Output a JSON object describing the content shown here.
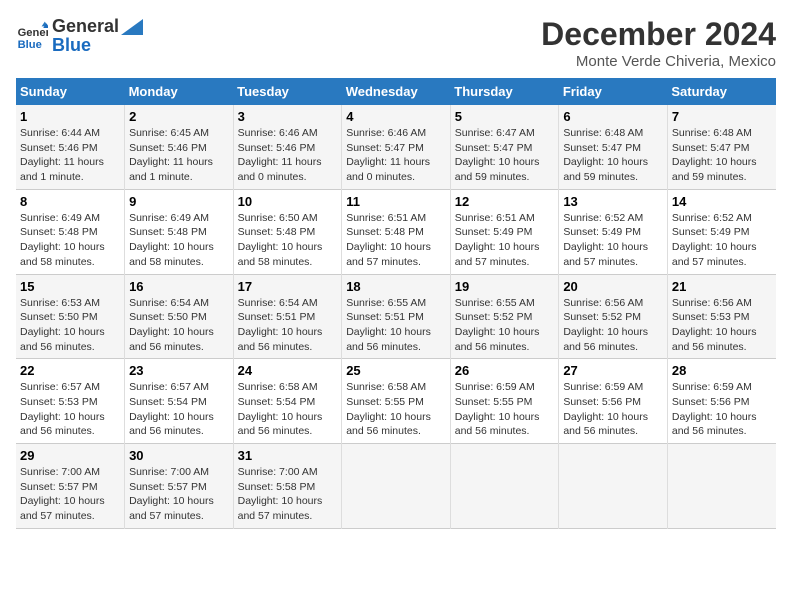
{
  "logo": {
    "line1": "General",
    "line2": "Blue"
  },
  "title": "December 2024",
  "subtitle": "Monte Verde Chiveria, Mexico",
  "days_of_week": [
    "Sunday",
    "Monday",
    "Tuesday",
    "Wednesday",
    "Thursday",
    "Friday",
    "Saturday"
  ],
  "weeks": [
    [
      {
        "day": "1",
        "detail": "Sunrise: 6:44 AM\nSunset: 5:46 PM\nDaylight: 11 hours\nand 1 minute."
      },
      {
        "day": "2",
        "detail": "Sunrise: 6:45 AM\nSunset: 5:46 PM\nDaylight: 11 hours\nand 1 minute."
      },
      {
        "day": "3",
        "detail": "Sunrise: 6:46 AM\nSunset: 5:46 PM\nDaylight: 11 hours\nand 0 minutes."
      },
      {
        "day": "4",
        "detail": "Sunrise: 6:46 AM\nSunset: 5:47 PM\nDaylight: 11 hours\nand 0 minutes."
      },
      {
        "day": "5",
        "detail": "Sunrise: 6:47 AM\nSunset: 5:47 PM\nDaylight: 10 hours\nand 59 minutes."
      },
      {
        "day": "6",
        "detail": "Sunrise: 6:48 AM\nSunset: 5:47 PM\nDaylight: 10 hours\nand 59 minutes."
      },
      {
        "day": "7",
        "detail": "Sunrise: 6:48 AM\nSunset: 5:47 PM\nDaylight: 10 hours\nand 59 minutes."
      }
    ],
    [
      {
        "day": "8",
        "detail": "Sunrise: 6:49 AM\nSunset: 5:48 PM\nDaylight: 10 hours\nand 58 minutes."
      },
      {
        "day": "9",
        "detail": "Sunrise: 6:49 AM\nSunset: 5:48 PM\nDaylight: 10 hours\nand 58 minutes."
      },
      {
        "day": "10",
        "detail": "Sunrise: 6:50 AM\nSunset: 5:48 PM\nDaylight: 10 hours\nand 58 minutes."
      },
      {
        "day": "11",
        "detail": "Sunrise: 6:51 AM\nSunset: 5:48 PM\nDaylight: 10 hours\nand 57 minutes."
      },
      {
        "day": "12",
        "detail": "Sunrise: 6:51 AM\nSunset: 5:49 PM\nDaylight: 10 hours\nand 57 minutes."
      },
      {
        "day": "13",
        "detail": "Sunrise: 6:52 AM\nSunset: 5:49 PM\nDaylight: 10 hours\nand 57 minutes."
      },
      {
        "day": "14",
        "detail": "Sunrise: 6:52 AM\nSunset: 5:49 PM\nDaylight: 10 hours\nand 57 minutes."
      }
    ],
    [
      {
        "day": "15",
        "detail": "Sunrise: 6:53 AM\nSunset: 5:50 PM\nDaylight: 10 hours\nand 56 minutes."
      },
      {
        "day": "16",
        "detail": "Sunrise: 6:54 AM\nSunset: 5:50 PM\nDaylight: 10 hours\nand 56 minutes."
      },
      {
        "day": "17",
        "detail": "Sunrise: 6:54 AM\nSunset: 5:51 PM\nDaylight: 10 hours\nand 56 minutes."
      },
      {
        "day": "18",
        "detail": "Sunrise: 6:55 AM\nSunset: 5:51 PM\nDaylight: 10 hours\nand 56 minutes."
      },
      {
        "day": "19",
        "detail": "Sunrise: 6:55 AM\nSunset: 5:52 PM\nDaylight: 10 hours\nand 56 minutes."
      },
      {
        "day": "20",
        "detail": "Sunrise: 6:56 AM\nSunset: 5:52 PM\nDaylight: 10 hours\nand 56 minutes."
      },
      {
        "day": "21",
        "detail": "Sunrise: 6:56 AM\nSunset: 5:53 PM\nDaylight: 10 hours\nand 56 minutes."
      }
    ],
    [
      {
        "day": "22",
        "detail": "Sunrise: 6:57 AM\nSunset: 5:53 PM\nDaylight: 10 hours\nand 56 minutes."
      },
      {
        "day": "23",
        "detail": "Sunrise: 6:57 AM\nSunset: 5:54 PM\nDaylight: 10 hours\nand 56 minutes."
      },
      {
        "day": "24",
        "detail": "Sunrise: 6:58 AM\nSunset: 5:54 PM\nDaylight: 10 hours\nand 56 minutes."
      },
      {
        "day": "25",
        "detail": "Sunrise: 6:58 AM\nSunset: 5:55 PM\nDaylight: 10 hours\nand 56 minutes."
      },
      {
        "day": "26",
        "detail": "Sunrise: 6:59 AM\nSunset: 5:55 PM\nDaylight: 10 hours\nand 56 minutes."
      },
      {
        "day": "27",
        "detail": "Sunrise: 6:59 AM\nSunset: 5:56 PM\nDaylight: 10 hours\nand 56 minutes."
      },
      {
        "day": "28",
        "detail": "Sunrise: 6:59 AM\nSunset: 5:56 PM\nDaylight: 10 hours\nand 56 minutes."
      }
    ],
    [
      {
        "day": "29",
        "detail": "Sunrise: 7:00 AM\nSunset: 5:57 PM\nDaylight: 10 hours\nand 57 minutes."
      },
      {
        "day": "30",
        "detail": "Sunrise: 7:00 AM\nSunset: 5:57 PM\nDaylight: 10 hours\nand 57 minutes."
      },
      {
        "day": "31",
        "detail": "Sunrise: 7:00 AM\nSunset: 5:58 PM\nDaylight: 10 hours\nand 57 minutes."
      },
      {
        "day": "",
        "detail": ""
      },
      {
        "day": "",
        "detail": ""
      },
      {
        "day": "",
        "detail": ""
      },
      {
        "day": "",
        "detail": ""
      }
    ]
  ]
}
